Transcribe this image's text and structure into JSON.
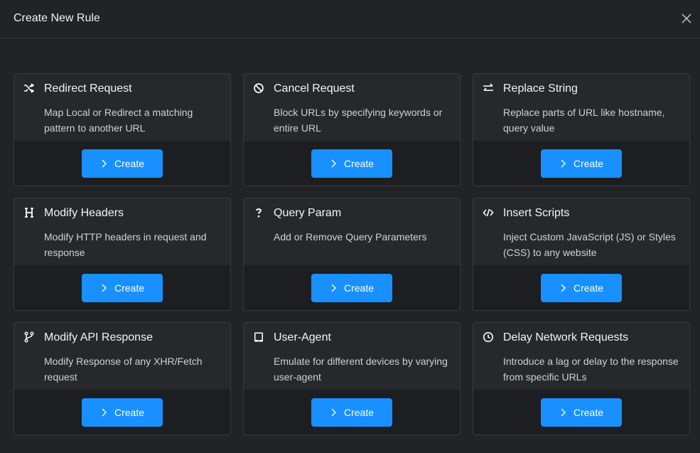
{
  "modal": {
    "title": "Create New Rule"
  },
  "cards": [
    {
      "icon": "shuffle-icon",
      "title": "Redirect Request",
      "desc": "Map Local or Redirect a matching pattern to another URL",
      "button": "Create"
    },
    {
      "icon": "block-icon",
      "title": "Cancel Request",
      "desc": "Block URLs by specifying keywords or entire URL",
      "button": "Create"
    },
    {
      "icon": "swap-icon",
      "title": "Replace String",
      "desc": "Replace parts of URL like hostname, query value",
      "button": "Create"
    },
    {
      "icon": "header-icon",
      "title": "Modify Headers",
      "desc": "Modify HTTP headers in request and response",
      "button": "Create"
    },
    {
      "icon": "question-icon",
      "title": "Query Param",
      "desc": "Add or Remove Query Parameters",
      "button": "Create"
    },
    {
      "icon": "code-icon",
      "title": "Insert Scripts",
      "desc": "Inject Custom JavaScript (JS) or Styles (CSS) to any website",
      "button": "Create"
    },
    {
      "icon": "branch-icon",
      "title": "Modify API Response",
      "desc": "Modify Response of any XHR/Fetch request",
      "button": "Create"
    },
    {
      "icon": "tablet-icon",
      "title": "User-Agent",
      "desc": "Emulate for different devices by varying user-agent",
      "button": "Create"
    },
    {
      "icon": "clock-icon",
      "title": "Delay Network Requests",
      "desc": "Introduce a lag or delay to the response from specific URLs",
      "button": "Create"
    }
  ],
  "colors": {
    "accent": "#1890ff",
    "background": "#212327",
    "card": "#26282c",
    "card_footer": "#1c1e21"
  }
}
